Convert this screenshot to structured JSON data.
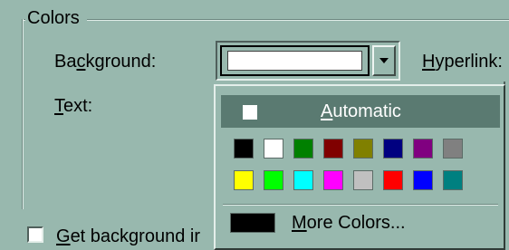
{
  "group": {
    "title": "Colors"
  },
  "labels": {
    "background_pre": "Ba",
    "background_key": "c",
    "background_post": "kground:",
    "text_key": "T",
    "text_post": "ext:",
    "hyperlink_key": "H",
    "hyperlink_post": "yperlink:",
    "get_background_key": "G",
    "get_background_post": "et background ir"
  },
  "background_combo": {
    "selected_color": "#ffffff"
  },
  "checkbox": {
    "checked": false
  },
  "palette": {
    "automatic_color": "#ffffff",
    "automatic_key": "A",
    "automatic_post": "utomatic",
    "swatches": [
      "#000000",
      "#ffffff",
      "#008000",
      "#800000",
      "#808000",
      "#000080",
      "#800080",
      "#808080",
      "#ffff00",
      "#00ff00",
      "#00ffff",
      "#ff00ff",
      "#c0c0c0",
      "#ff0000",
      "#0000ff",
      "#008080"
    ],
    "more_color": "#000000",
    "more_key": "M",
    "more_post": "ore Colors..."
  },
  "colors": {
    "dialog_bg": "#98b8ae",
    "highlight": "#5a7a71"
  }
}
